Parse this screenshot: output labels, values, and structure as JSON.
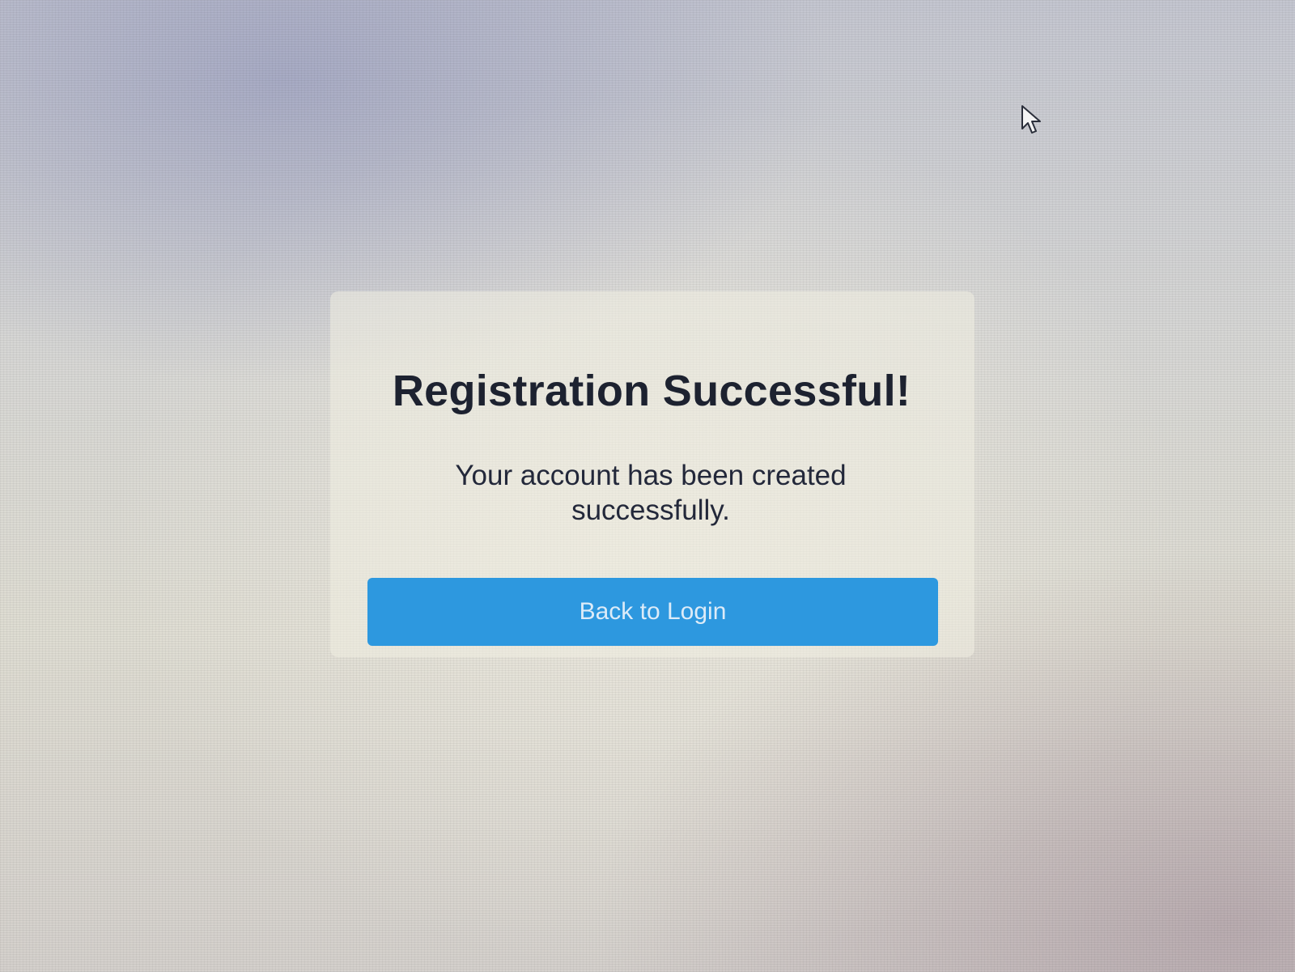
{
  "dialog": {
    "title": "Registration Successful!",
    "message": "Your account has been created successfully.",
    "button_label": "Back to Login"
  },
  "colors": {
    "accent": "#2d98df",
    "title_text": "#1d2230",
    "button_text": "#dcebf8"
  },
  "icons": {
    "cursor": "mouse-pointer-icon"
  }
}
